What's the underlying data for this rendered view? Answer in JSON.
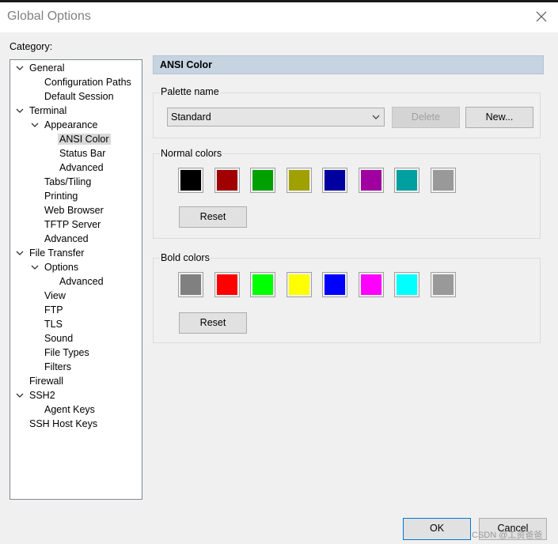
{
  "window": {
    "title": "Global Options"
  },
  "category": {
    "label": "Category:",
    "tree": [
      {
        "label": "General",
        "expanded": true
      },
      {
        "label": "Configuration Paths"
      },
      {
        "label": "Default Session"
      },
      {
        "label": "Terminal",
        "expanded": true
      },
      {
        "label": "Appearance",
        "expanded": true
      },
      {
        "label": "ANSI Color",
        "selected": true
      },
      {
        "label": "Status Bar"
      },
      {
        "label": "Advanced"
      },
      {
        "label": "Tabs/Tiling"
      },
      {
        "label": "Printing"
      },
      {
        "label": "Web Browser"
      },
      {
        "label": "TFTP Server"
      },
      {
        "label": "Advanced"
      },
      {
        "label": "File Transfer",
        "expanded": true
      },
      {
        "label": "Options",
        "expanded": true
      },
      {
        "label": "Advanced"
      },
      {
        "label": "View"
      },
      {
        "label": "FTP"
      },
      {
        "label": "TLS"
      },
      {
        "label": "Sound"
      },
      {
        "label": "File Types"
      },
      {
        "label": "Filters"
      },
      {
        "label": "Firewall"
      },
      {
        "label": "SSH2",
        "expanded": true
      },
      {
        "label": "Agent Keys"
      },
      {
        "label": "SSH Host Keys"
      }
    ]
  },
  "panel": {
    "header": "ANSI Color",
    "palette": {
      "label": "Palette name",
      "selected": "Standard",
      "delete_label": "Delete",
      "new_label": "New..."
    },
    "normal": {
      "label": "Normal colors",
      "reset_label": "Reset",
      "colors": [
        "#000000",
        "#a00000",
        "#00a000",
        "#a0a000",
        "#0000a0",
        "#a000a0",
        "#00a0a0",
        "#999999"
      ]
    },
    "bold": {
      "label": "Bold colors",
      "reset_label": "Reset",
      "colors": [
        "#808080",
        "#ff0000",
        "#00ff00",
        "#ffff00",
        "#0000ff",
        "#ff00ff",
        "#00ffff",
        "#999999"
      ]
    }
  },
  "footer": {
    "ok_label": "OK",
    "cancel_label": "Cancel",
    "watermark": "CSDN @工资爸爸"
  }
}
